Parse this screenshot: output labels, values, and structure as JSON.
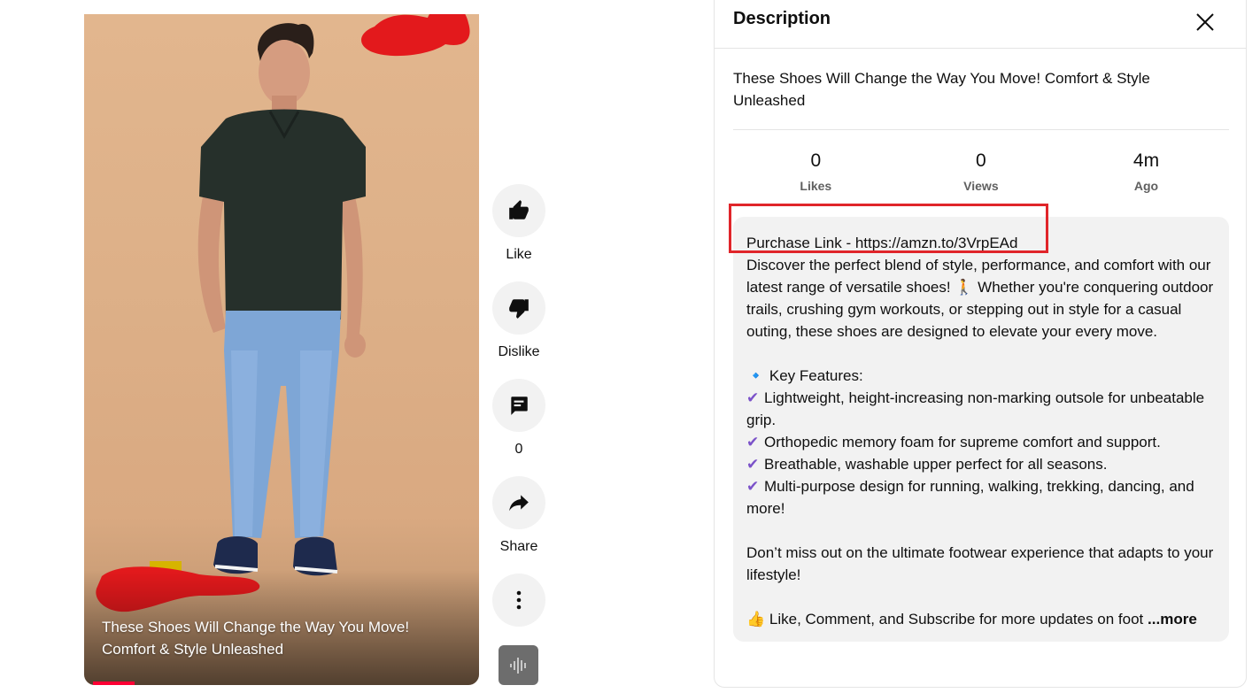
{
  "video": {
    "title": "These Shoes Will Change the Way You Move! Comfort & Style Unleashed",
    "progress_fraction": 0.11
  },
  "actions": {
    "like_label": "Like",
    "dislike_label": "Dislike",
    "comments_count": "0",
    "share_label": "Share"
  },
  "panel": {
    "title": "Description",
    "video_name": "These Shoes Will Change the Way You Move! Comfort & Style Unleashed",
    "stats": [
      {
        "value": "0",
        "label": "Likes"
      },
      {
        "value": "0",
        "label": "Views"
      },
      {
        "value": "4m",
        "label": "Ago"
      }
    ],
    "description": {
      "purchase_link": "Purchase Link - https://amzn.to/3VrpEAd",
      "intro": "Discover the perfect blend of style, performance, and comfort with our latest range of versatile shoes! 🚶 Whether you're conquering outdoor trails, crushing gym workouts, or stepping out in style for a casual outing, these shoes are designed to elevate your every move.",
      "features_heading": "🔹 Key Features:",
      "features": [
        "Lightweight, height-increasing non-marking outsole for unbeatable grip.",
        "Orthopedic memory foam for supreme comfort and support.",
        "Breathable, washable upper perfect for all seasons.",
        "Multi-purpose design for running, walking, trekking, dancing, and more!"
      ],
      "outro": "Don’t miss out on the ultimate footwear experience that adapts to your lifestyle!",
      "cta": "👍 Like, Comment, and Subscribe for more updates on foot",
      "more_label": "...more"
    }
  },
  "colors": {
    "highlight_box": "#e0252a",
    "redaction": "#e3191c",
    "checkmark": "#7b52c9",
    "progress": "#ff0033"
  }
}
